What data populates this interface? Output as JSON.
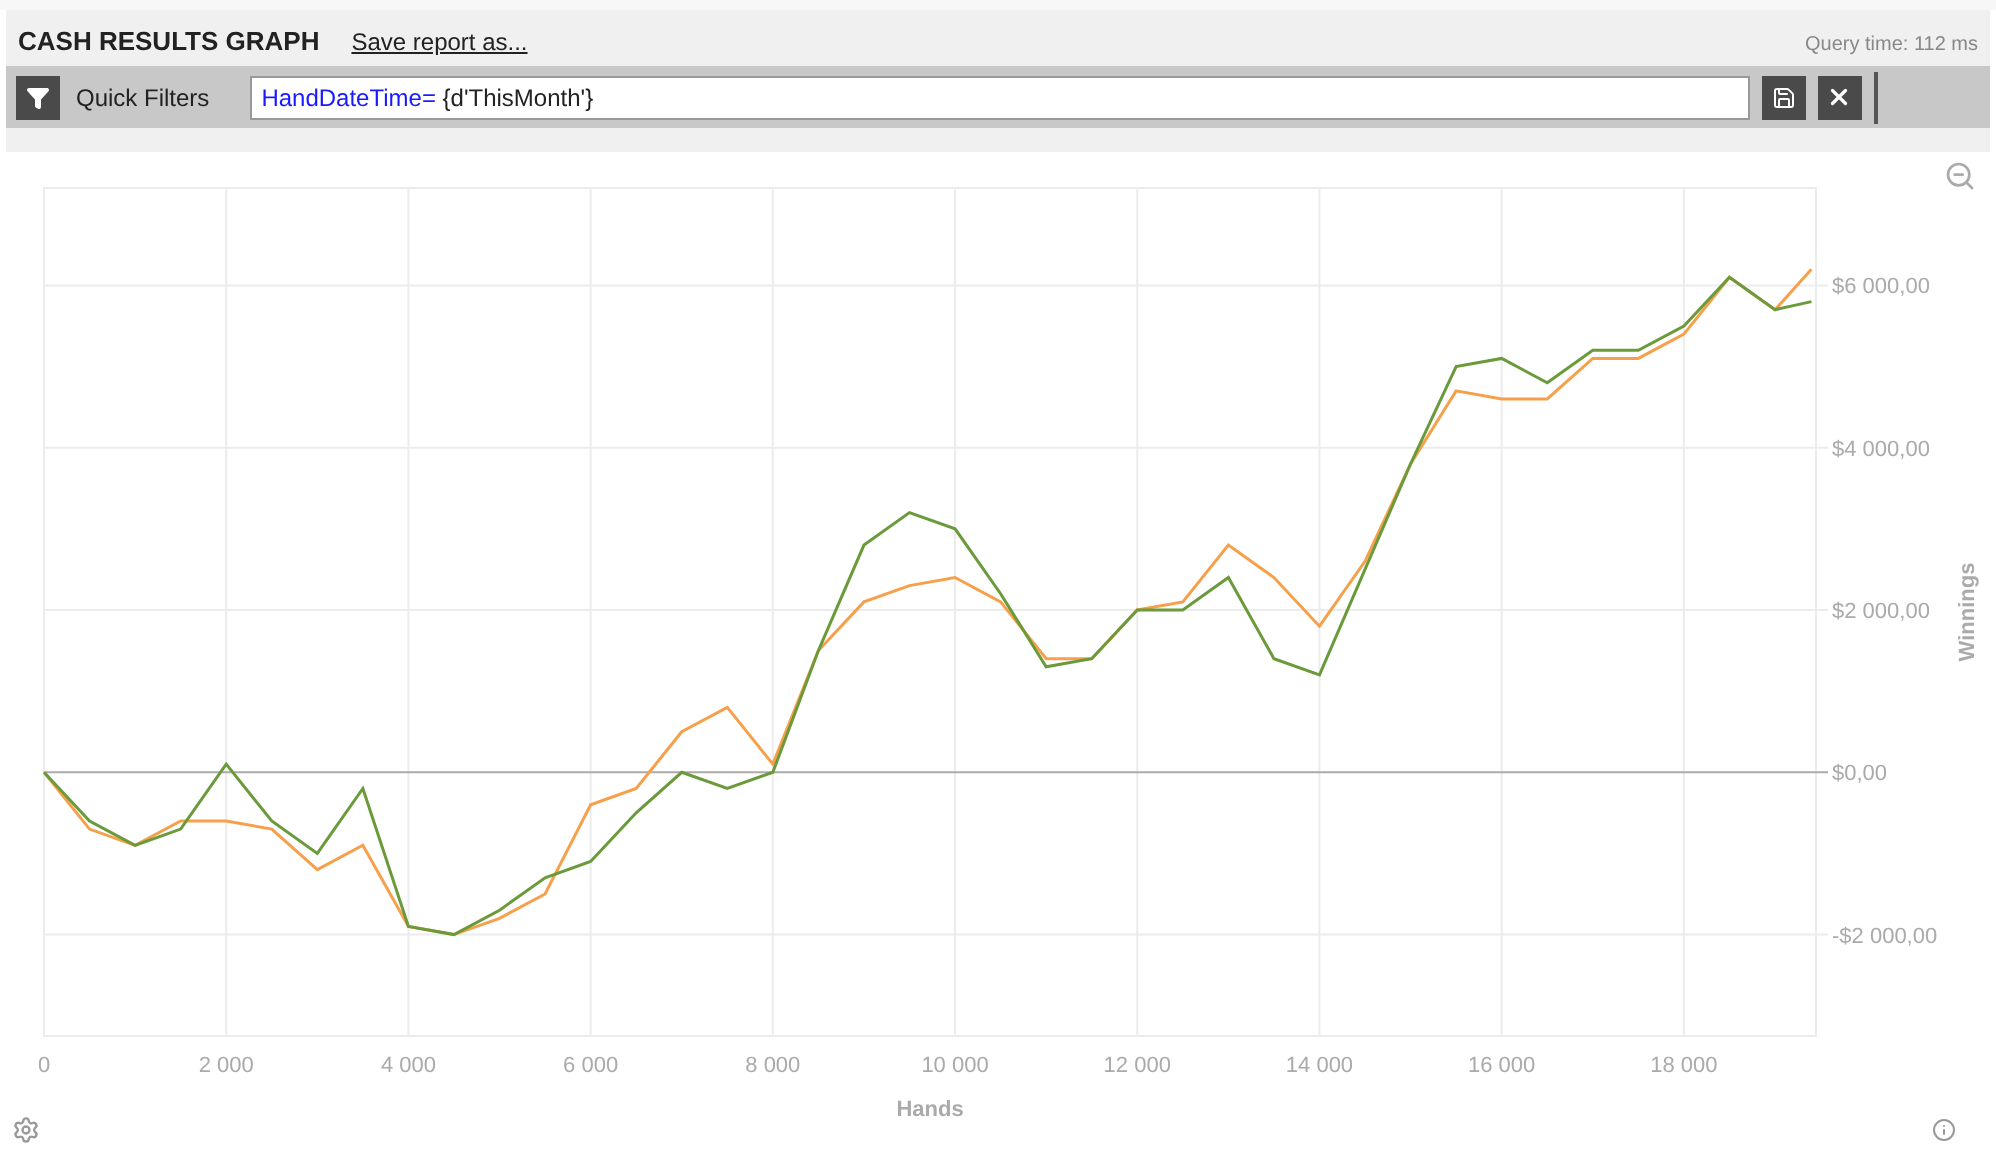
{
  "header": {
    "title": "CASH RESULTS GRAPH",
    "save_link": "Save report as...",
    "query_time": "Query time: 112 ms"
  },
  "filter_bar": {
    "label": "Quick Filters",
    "field_key": "HandDateTime=",
    "field_value": " {d'ThisMonth'}"
  },
  "chart_data": {
    "type": "line",
    "grid": true,
    "xlabel": "Hands",
    "ylabel": "Winnings",
    "xlim": [
      0,
      19450
    ],
    "ylim": [
      -3250,
      7200
    ],
    "x": [
      0,
      500,
      1000,
      1500,
      2000,
      2500,
      3000,
      3500,
      4000,
      4500,
      5000,
      5500,
      6000,
      6500,
      7000,
      7500,
      8000,
      8500,
      9000,
      9500,
      10000,
      10500,
      11000,
      11500,
      12000,
      12500,
      13000,
      13500,
      14000,
      14500,
      15000,
      15500,
      16000,
      16500,
      17000,
      17500,
      18000,
      18500,
      19000,
      19400
    ],
    "series": [
      {
        "color": "#f7a04b",
        "values": [
          0,
          -700,
          -900,
          -600,
          -600,
          -700,
          -1200,
          -900,
          -1900,
          -2000,
          -1800,
          -1500,
          -400,
          -200,
          500,
          800,
          100,
          1500,
          2100,
          2300,
          2400,
          2100,
          1400,
          1400,
          2000,
          2100,
          2800,
          2400,
          1800,
          2600,
          3800,
          4700,
          4600,
          4600,
          5100,
          5100,
          5400,
          6100,
          5700,
          6200
        ]
      },
      {
        "color": "#6a9a3a",
        "values": [
          0,
          -600,
          -900,
          -700,
          100,
          -600,
          -1000,
          -200,
          -1900,
          -2000,
          -1700,
          -1300,
          -1100,
          -500,
          0,
          -200,
          0,
          1500,
          2800,
          3200,
          3000,
          2200,
          1300,
          1400,
          2000,
          2000,
          2400,
          1400,
          1200,
          2500,
          3800,
          5000,
          5100,
          4800,
          5200,
          5200,
          5500,
          6100,
          5700,
          5800
        ]
      }
    ],
    "xticks": [
      {
        "value": 0,
        "label": "0"
      },
      {
        "value": 2000,
        "label": "2 000"
      },
      {
        "value": 4000,
        "label": "4 000"
      },
      {
        "value": 6000,
        "label": "6 000"
      },
      {
        "value": 8000,
        "label": "8 000"
      },
      {
        "value": 10000,
        "label": "10 000"
      },
      {
        "value": 12000,
        "label": "12 000"
      },
      {
        "value": 14000,
        "label": "14 000"
      },
      {
        "value": 16000,
        "label": "16 000"
      },
      {
        "value": 18000,
        "label": "18 000"
      }
    ],
    "yticks": [
      {
        "value": -2000,
        "label": "-$2 000,00"
      },
      {
        "value": 0,
        "label": "$0,00"
      },
      {
        "value": 2000,
        "label": "$2 000,00"
      },
      {
        "value": 4000,
        "label": "$4 000,00"
      },
      {
        "value": 6000,
        "label": "$6 000,00"
      }
    ]
  }
}
